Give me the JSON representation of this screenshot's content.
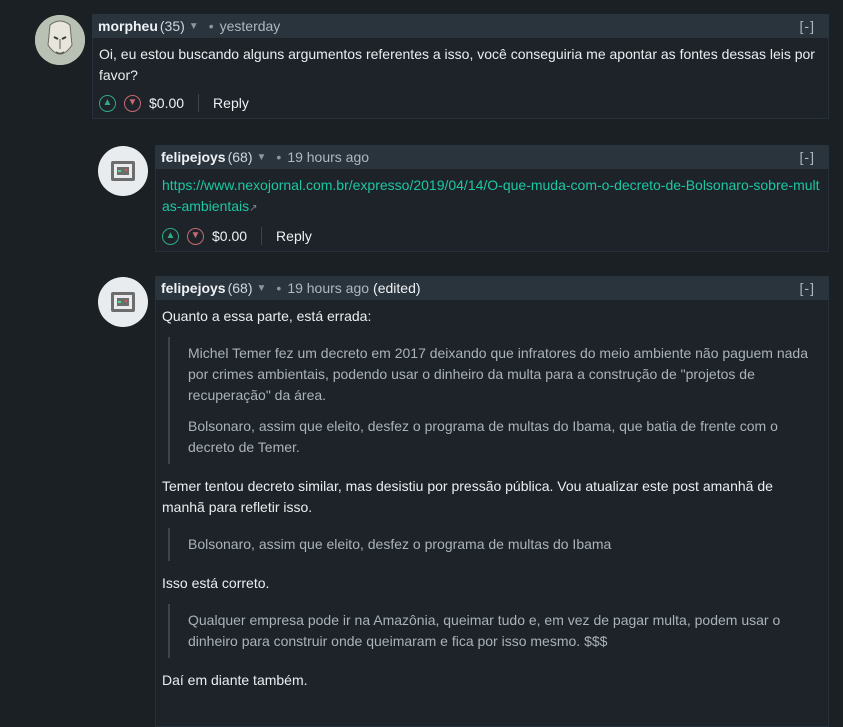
{
  "comments": [
    {
      "author": "morpheu",
      "rep": "(35)",
      "time": "yesterday",
      "collapse": "[-]",
      "body": "Oi, eu estou buscando alguns argumentos referentes a isso, você conseguiria me apontar as fontes dessas leis por favor?",
      "amount": "$0.00",
      "reply": "Reply"
    },
    {
      "author": "felipejoys",
      "rep": "(68)",
      "time": "19 hours ago",
      "collapse": "[-]",
      "link": "https://www.nexojornal.com.br/expresso/2019/04/14/O-que-muda-com-o-decreto-de-Bolsonaro-sobre-multas-ambientais",
      "amount": "$0.00",
      "reply": "Reply"
    },
    {
      "author": "felipejoys",
      "rep": "(68)",
      "time": "19 hours ago",
      "edited": "(edited)",
      "collapse": "[-]",
      "p1": "Quanto a essa parte, está errada:",
      "q1a": "Michel Temer fez um decreto em 2017 deixando que infratores do meio ambiente não paguem nada por crimes ambientais, podendo usar o dinheiro da multa para a construção de \"projetos de recuperação\" da área.",
      "q1b": "Bolsonaro, assim que eleito, desfez o programa de multas do Ibama, que batia de frente com o decreto de Temer.",
      "p2": "Temer tentou decreto similar, mas desistiu por pressão pública. Vou atualizar este post amanhã de manhã para refletir isso.",
      "q2": "Bolsonaro, assim que eleito, desfez o programa de multas do Ibama",
      "p3": "Isso está correto.",
      "q3": "Qualquer empresa pode ir na Amazônia, queimar tudo e, em vez de pagar multa, podem usar o dinheiro para construir onde queimaram e fica por isso mesmo. $$$",
      "p4": "Daí em diante também."
    }
  ],
  "colors": {
    "background": "#1b2025",
    "header": "#2a343d",
    "link": "#1cc7a3",
    "upvote": "#2fa983",
    "downvote": "#c56a72"
  }
}
